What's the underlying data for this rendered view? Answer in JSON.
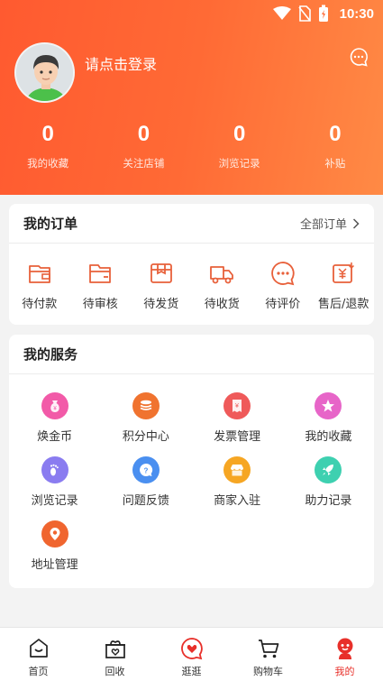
{
  "status_bar": {
    "time": "10:30"
  },
  "profile": {
    "login_prompt": "请点击登录"
  },
  "stats": [
    {
      "value": "0",
      "label": "我的收藏"
    },
    {
      "value": "0",
      "label": "关注店铺"
    },
    {
      "value": "0",
      "label": "浏览记录"
    },
    {
      "value": "0",
      "label": "补贴"
    }
  ],
  "orders": {
    "title": "我的订单",
    "all_label": "全部订单",
    "items": [
      {
        "label": "待付款",
        "icon": "wallet-icon"
      },
      {
        "label": "待审核",
        "icon": "folder-icon"
      },
      {
        "label": "待发货",
        "icon": "package-icon"
      },
      {
        "label": "待收货",
        "icon": "truck-icon"
      },
      {
        "label": "待评价",
        "icon": "comment-icon"
      },
      {
        "label": "售后/退款",
        "icon": "refund-icon"
      }
    ]
  },
  "services": {
    "title": "我的服务",
    "items": [
      {
        "label": "焕金币",
        "icon": "coin-bag-icon",
        "color": "#f25aa8"
      },
      {
        "label": "积分中心",
        "icon": "coins-icon",
        "color": "#f0732f"
      },
      {
        "label": "发票管理",
        "icon": "invoice-icon",
        "color": "#ef5a5a"
      },
      {
        "label": "我的收藏",
        "icon": "star-icon",
        "color": "#e765c8"
      },
      {
        "label": "浏览记录",
        "icon": "footprint-icon",
        "color": "#8a7cf0"
      },
      {
        "label": "问题反馈",
        "icon": "question-icon",
        "color": "#4a8ff0"
      },
      {
        "label": "商家入驻",
        "icon": "shop-icon",
        "color": "#f6a623"
      },
      {
        "label": "助力记录",
        "icon": "rocket-icon",
        "color": "#3ed0b0"
      },
      {
        "label": "地址管理",
        "icon": "location-icon",
        "color": "#f0652f"
      }
    ]
  },
  "tabbar": {
    "items": [
      {
        "label": "首页",
        "icon": "home-icon"
      },
      {
        "label": "回收",
        "icon": "recycle-gift-icon"
      },
      {
        "label": "逛逛",
        "icon": "heart-chat-icon"
      },
      {
        "label": "购物车",
        "icon": "cart-icon"
      },
      {
        "label": "我的",
        "icon": "profile-icon",
        "active": true
      }
    ]
  },
  "colors": {
    "accent": "#ff5a30",
    "icon_line": "#e8603a",
    "active_tab": "#e8302a"
  }
}
